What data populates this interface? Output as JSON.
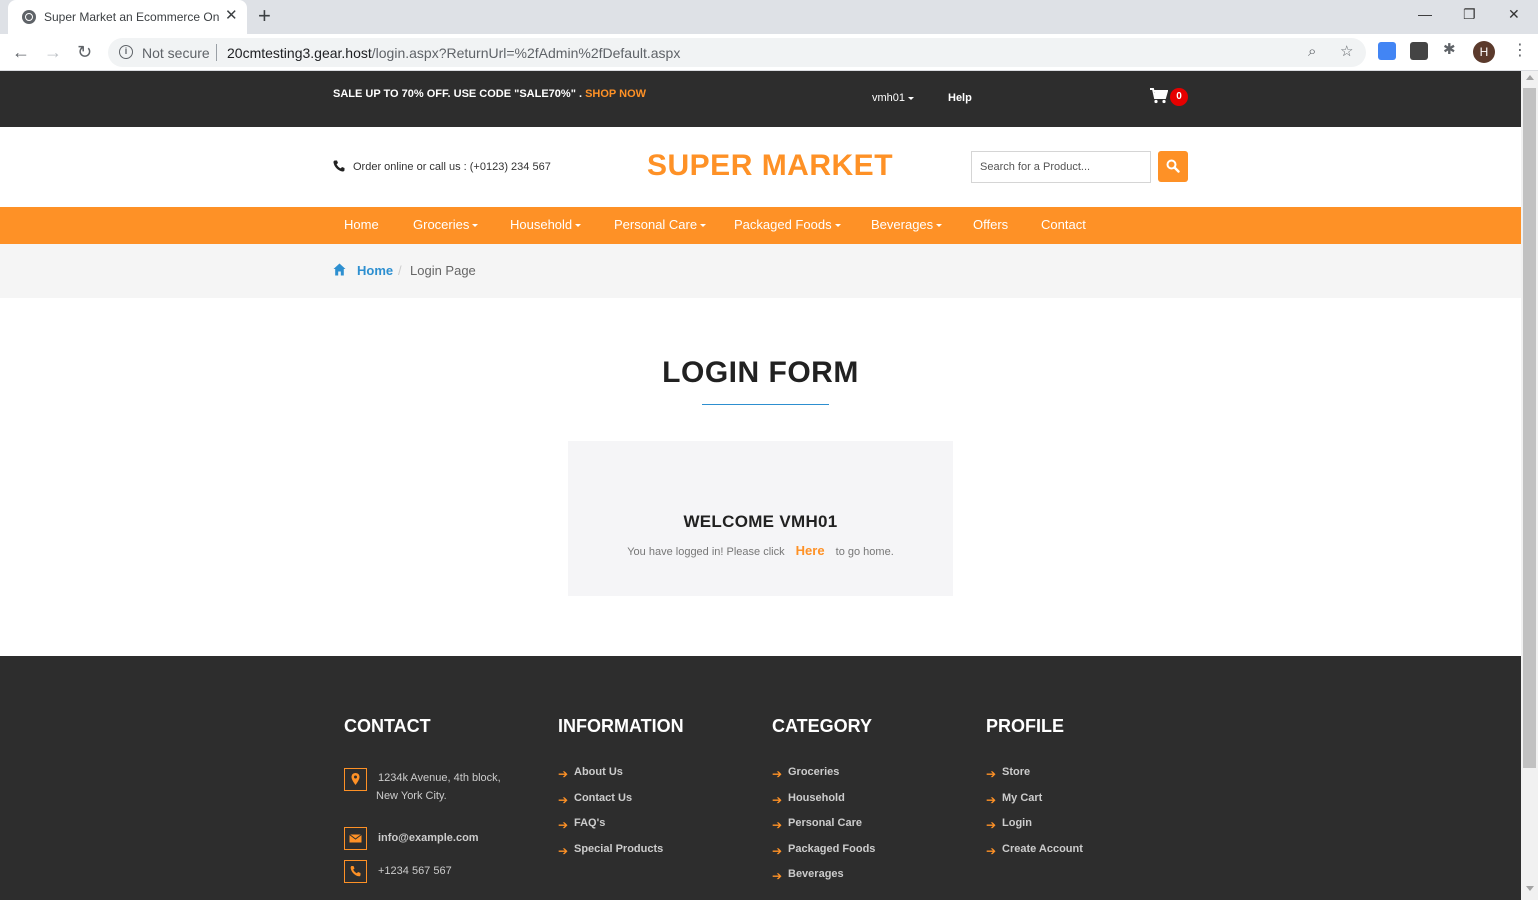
{
  "browser": {
    "tab_title": "Super Market an Ecommerce Online",
    "security_label": "Not secure",
    "url_host": "20cmtesting3.gear.host",
    "url_path": "/login.aspx?ReturnUrl=%2fAdmin%2fDefault.aspx",
    "profile_initial": "H"
  },
  "topbar": {
    "promo_text": "SALE UP TO 70% OFF. USE CODE \"SALE70%\" .",
    "promo_link": "SHOP NOW",
    "user": "vmh01",
    "help": "Help",
    "cart_count": "0"
  },
  "header": {
    "order_text": "Order online or call us : (+0123) 234 567",
    "logo": "SUPER MARKET",
    "search_placeholder": "Search for a Product..."
  },
  "nav": {
    "items": [
      {
        "label": "Home",
        "dropdown": false
      },
      {
        "label": "Groceries",
        "dropdown": true
      },
      {
        "label": "Household",
        "dropdown": true
      },
      {
        "label": "Personal Care",
        "dropdown": true
      },
      {
        "label": "Packaged Foods",
        "dropdown": true
      },
      {
        "label": "Beverages",
        "dropdown": true
      },
      {
        "label": "Offers",
        "dropdown": false
      },
      {
        "label": "Contact",
        "dropdown": false
      }
    ]
  },
  "breadcrumb": {
    "home": "Home",
    "current": "Login Page"
  },
  "login": {
    "title": "LOGIN FORM",
    "welcome": "WELCOME VMH01",
    "message_before": "You have logged in! Please click",
    "here_link": "Here",
    "message_after": "to go home."
  },
  "footer": {
    "contact": {
      "heading": "CONTACT",
      "address_line1": "1234k Avenue, 4th block,",
      "address_line2": "New York City.",
      "email": "info@example.com",
      "phone": "+1234 567 567"
    },
    "information": {
      "heading": "INFORMATION",
      "links": [
        "About Us",
        "Contact Us",
        "FAQ's",
        "Special Products"
      ]
    },
    "category": {
      "heading": "CATEGORY",
      "links": [
        "Groceries",
        "Household",
        "Personal Care",
        "Packaged Foods",
        "Beverages"
      ]
    },
    "profile": {
      "heading": "PROFILE",
      "links": [
        "Store",
        "My Cart",
        "Login",
        "Create Account"
      ]
    }
  },
  "colors": {
    "accent": "#fe9126",
    "dark": "#2d2d2d",
    "link_blue": "#2d8fd0",
    "badge_red": "#e60000"
  }
}
